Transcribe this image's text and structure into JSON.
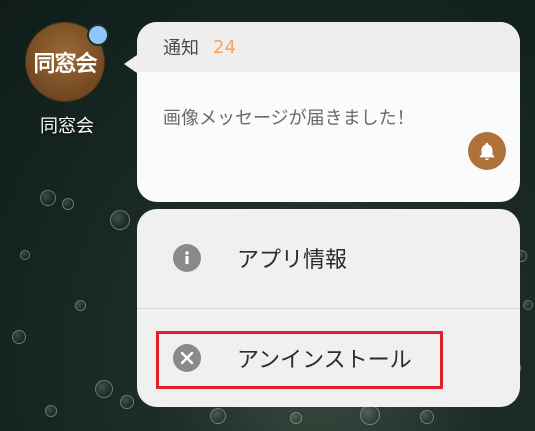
{
  "app": {
    "icon_text": "同窓会",
    "label": "同窓会",
    "badge_color": "#8ec7f6"
  },
  "notification": {
    "title": "通知",
    "count": "24",
    "message": "画像メッセージが届きました！",
    "icon": "bell-icon",
    "accent_color": "#f4a25e"
  },
  "menu": {
    "items": [
      {
        "label": "アプリ情報",
        "icon": "info-icon"
      },
      {
        "label": "アンインストール",
        "icon": "close-circle-icon"
      }
    ],
    "highlight_color": "#e0202a"
  }
}
